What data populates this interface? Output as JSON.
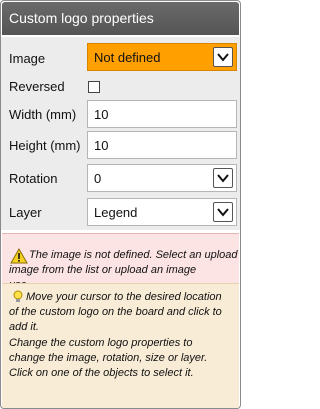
{
  "panel": {
    "title": "Custom logo properties"
  },
  "form": {
    "image_label": "Image",
    "image_value": "Not defined",
    "reversed_label": "Reversed",
    "width_label": "Width (mm)",
    "width_value": "10",
    "height_label": "Height (mm)",
    "height_value": "10",
    "rotation_label": "Rotation",
    "rotation_value": "0",
    "layer_label": "Layer",
    "layer_value": "Legend"
  },
  "warning": {
    "line1": "The image is not defined. Select an upload",
    "line2": "image from the list or upload an image",
    "line3": "use."
  },
  "info": {
    "line1": "Move your cursor to the desired location",
    "line2": "of the custom logo on the board and click to",
    "line3": "add it.",
    "line4": "Change the custom logo properties to",
    "line5": "change the image, rotation, size or layer.",
    "line6": "Click on one of the objects to select it."
  },
  "colors": {
    "header": "#5f5f5f",
    "image_field": "#ff9f00",
    "warning_bg": "#fde4e4",
    "info_bg": "#f8ecd6"
  }
}
